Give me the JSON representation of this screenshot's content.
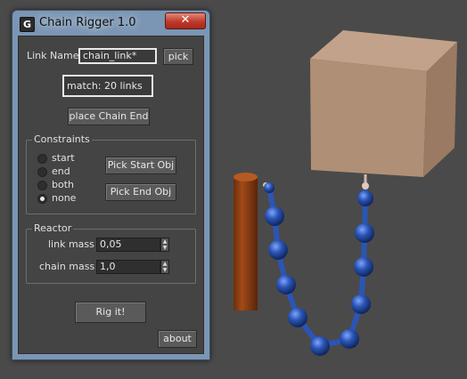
{
  "window": {
    "title": "Chain Rigger 1.0",
    "icon": "gear-icon",
    "close_label": "✕"
  },
  "link": {
    "label": "Link Name:",
    "value": "chain_link*",
    "pick_label": "pick"
  },
  "match_text": "match: 20 links",
  "place_chain_end_label": "place Chain End",
  "constraints": {
    "title": "Constraints",
    "options": [
      {
        "label": "start",
        "selected": false
      },
      {
        "label": "end",
        "selected": false
      },
      {
        "label": "both",
        "selected": false
      },
      {
        "label": "none",
        "selected": true
      }
    ],
    "pick_start_label": "Pick Start Obj",
    "pick_end_label": "Pick End Obj"
  },
  "reactor": {
    "title": "Reactor",
    "link_mass_label": "link mass",
    "link_mass_value": "0,05",
    "chain_mass_label": "chain mass",
    "chain_mass_value": "1,0"
  },
  "rig_label": "Rig it!",
  "about_label": "about",
  "colors": {
    "viewport_bg": "#4a4a4a",
    "panel_bg": "#444444",
    "window_frame": "#7b96b4",
    "box": "#b08f77",
    "post": "#8a3f15",
    "chain": "#2b55b5"
  }
}
